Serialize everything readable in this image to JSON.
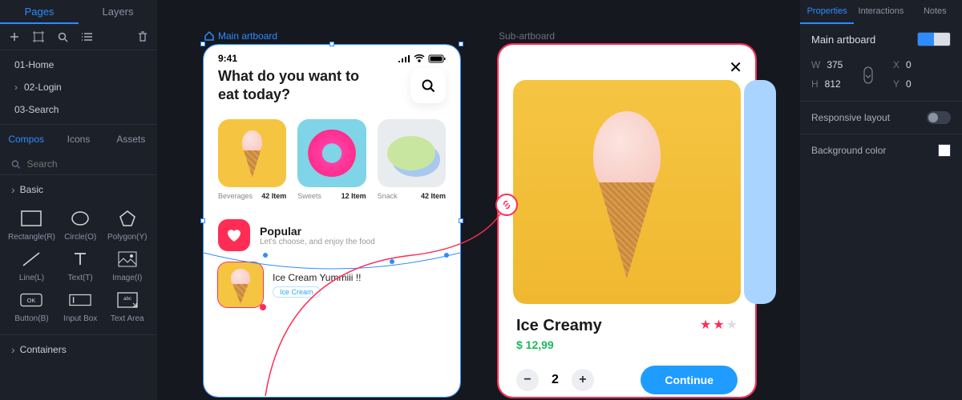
{
  "left": {
    "tabs": [
      "Pages",
      "Layers"
    ],
    "active_tab": 0,
    "pages": [
      "01-Home",
      "02-Login",
      "03-Search"
    ],
    "assets_tabs": [
      "Compos",
      "Icons",
      "Assets"
    ],
    "assets_active": 0,
    "search_placeholder": "Search",
    "sections": {
      "basic": "Basic",
      "containers": "Containers"
    },
    "compos": [
      {
        "label": "Rectangle(R)",
        "icon": "rect"
      },
      {
        "label": "Circle(O)",
        "icon": "circle"
      },
      {
        "label": "Polygon(Y)",
        "icon": "polygon"
      },
      {
        "label": "Line(L)",
        "icon": "line"
      },
      {
        "label": "Text(T)",
        "icon": "text"
      },
      {
        "label": "Image(I)",
        "icon": "image"
      },
      {
        "label": "Button(B)",
        "icon": "button"
      },
      {
        "label": "Input Box",
        "icon": "input"
      },
      {
        "label": "Text Area",
        "icon": "textarea"
      }
    ]
  },
  "canvas": {
    "main_label": "Main artboard",
    "sub_label": "Sub-artboard",
    "phone": {
      "time": "9:41",
      "hero": "What do you want to eat today?",
      "categories": [
        {
          "name": "Beverages",
          "count": "42 Item"
        },
        {
          "name": "Sweets",
          "count": "12 Item"
        },
        {
          "name": "Snack",
          "count": "42 Item"
        }
      ],
      "popular": {
        "title": "Popular",
        "subtitle": "Let's choose, and enjoy the food"
      },
      "food_item": {
        "name": "Ice Cream Yummiii !!",
        "tag": "Ice Cream"
      }
    },
    "detail": {
      "name": "Ice Creamy",
      "price": "$ 12,99",
      "stars": 2,
      "qty": "2",
      "continue": "Continue"
    }
  },
  "right": {
    "tabs": [
      "Properties",
      "Interactions",
      "Notes"
    ],
    "active_tab": 0,
    "artboard_name": "Main artboard",
    "dims": {
      "W": "375",
      "H": "812",
      "X": "0",
      "Y": "0"
    },
    "responsive_label": "Responsive layout",
    "bgcolor_label": "Background color"
  }
}
